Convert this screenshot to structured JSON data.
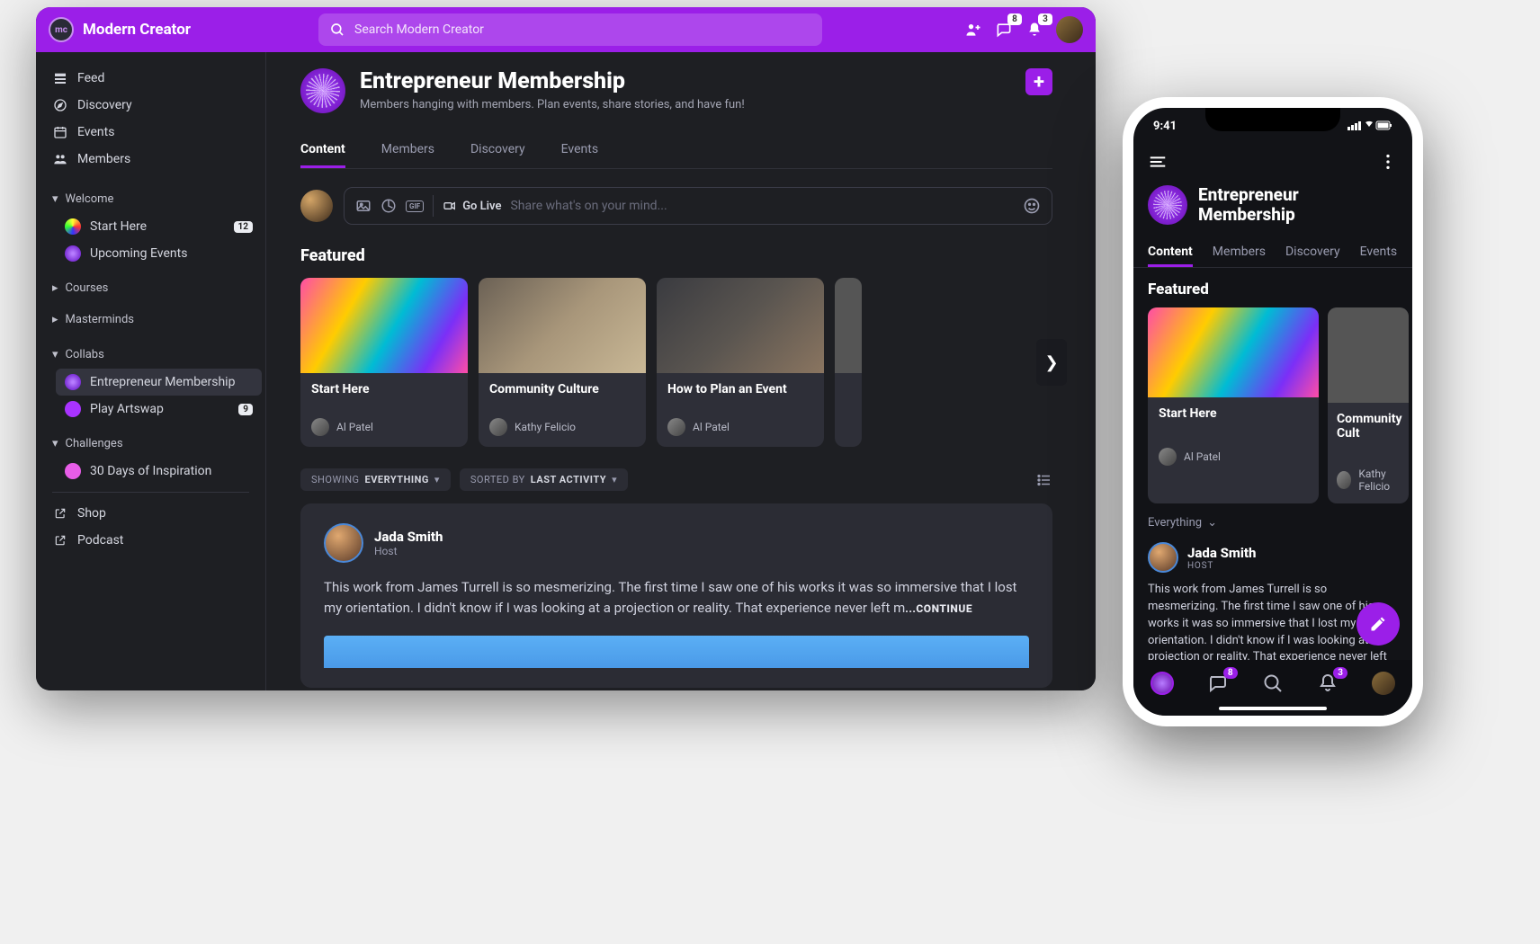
{
  "brand": {
    "name": "Modern Creator",
    "logo_text": "mc"
  },
  "search": {
    "placeholder": "Search Modern Creator"
  },
  "topbar": {
    "chat_badge": "8",
    "bell_badge": "3"
  },
  "sidebar": {
    "primary": [
      {
        "label": "Feed"
      },
      {
        "label": "Discovery"
      },
      {
        "label": "Events"
      },
      {
        "label": "Members"
      }
    ],
    "groups": [
      {
        "label": "Welcome",
        "open": true,
        "items": [
          {
            "label": "Start Here",
            "badge": "12",
            "swatch": "rainbow"
          },
          {
            "label": "Upcoming Events",
            "swatch": "purple"
          }
        ]
      },
      {
        "label": "Courses",
        "open": false
      },
      {
        "label": "Masterminds",
        "open": false
      },
      {
        "label": "Collabs",
        "open": true,
        "items": [
          {
            "label": "Entrepreneur Membership",
            "swatch": "purple",
            "active": true
          },
          {
            "label": "Play Artswap",
            "badge": "9",
            "swatch": "violet"
          }
        ]
      },
      {
        "label": "Challenges",
        "open": true,
        "items": [
          {
            "label": "30 Days of Inspiration",
            "swatch": "pink"
          }
        ]
      }
    ],
    "external": [
      {
        "label": "Shop"
      },
      {
        "label": "Podcast"
      }
    ]
  },
  "space": {
    "title": "Entrepreneur Membership",
    "subtitle": "Members hanging with members. Plan events, share stories, and have fun!",
    "tabs": [
      "Content",
      "Members",
      "Discovery",
      "Events"
    ],
    "active_tab": "Content"
  },
  "composer": {
    "go_live": "Go Live",
    "placeholder": "Share what's on your mind..."
  },
  "featured": {
    "heading": "Featured",
    "cards": [
      {
        "title": "Start Here",
        "author": "Al Patel",
        "img": "swirl"
      },
      {
        "title": "Community Culture",
        "author": "Kathy Felicio",
        "img": "cafe"
      },
      {
        "title": "How to Plan an Event",
        "author": "Al Patel",
        "img": "event"
      }
    ]
  },
  "filters": {
    "showing_label": "SHOWING",
    "showing_value": "EVERYTHING",
    "sort_label": "SORTED BY",
    "sort_value": "LAST ACTIVITY"
  },
  "post": {
    "author": "Jada Smith",
    "role": "Host",
    "text": "This work from James Turrell is so mesmerizing. The first time I saw one of his works it was so immersive that I lost my orientation. I didn't know if I was looking at a projection or reality. That experience never left m",
    "continue": "...CONTINUE"
  },
  "phone": {
    "time": "9:41",
    "title": "Entrepreneur Membership",
    "tabs": [
      "Content",
      "Members",
      "Discovery",
      "Events"
    ],
    "featured_heading": "Featured",
    "cards": [
      {
        "title": "Start Here",
        "author": "Al Patel",
        "img": "swirl"
      },
      {
        "title": "Community Cult",
        "author": "Kathy Felicio",
        "img": "event"
      }
    ],
    "filter": "Everything",
    "post": {
      "author": "Jada Smith",
      "role": "HOST",
      "text": "This work from James Turrell is so mesmerizing. The first time I saw one of his works it was so immersive that I lost my orientation. I didn't know if I was looking at a projection or reality. That experience never left m   CONTINUE"
    },
    "nav_badges": {
      "chat": "8",
      "bell": "3"
    }
  }
}
